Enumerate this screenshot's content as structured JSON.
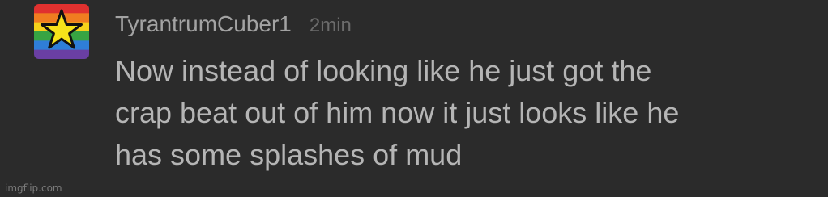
{
  "comment": {
    "avatar": {
      "icon": "rainbow-star-avatar",
      "stripe_colors": [
        "#e0312f",
        "#f07d20",
        "#f6d21a",
        "#37a443",
        "#2f7ed8",
        "#6a3fa3"
      ],
      "star_color": "#f6e21a"
    },
    "username": "TyrantrumCuber1",
    "timestamp": "2min",
    "body_lines": [
      "Now instead of looking like he just got the",
      "crap beat out of him now it just looks like he",
      "has some splashes of mud"
    ]
  },
  "watermark": "imgflip.com"
}
